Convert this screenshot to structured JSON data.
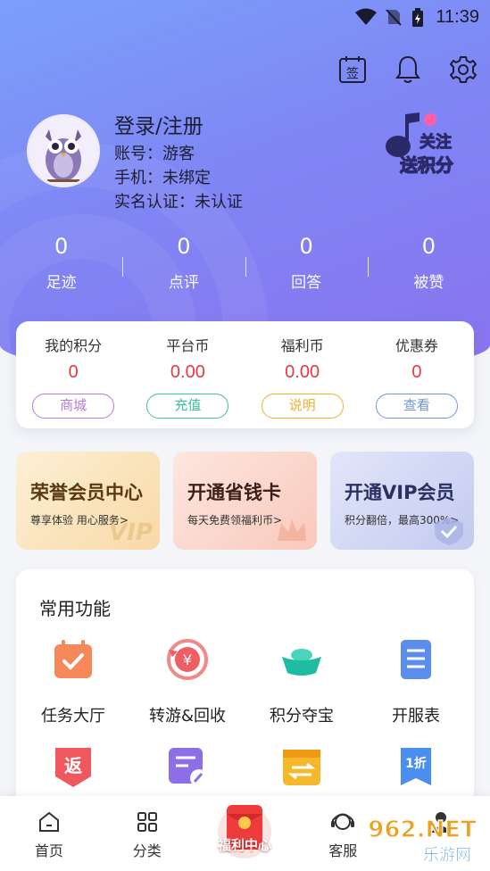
{
  "status_bar": {
    "time": "11:39"
  },
  "profile": {
    "name": "登录/注册",
    "account": "账号：游客",
    "phone": "手机：未绑定",
    "realname": "实名认证：未认证",
    "promo_line1": "关注",
    "promo_line2": "送积分"
  },
  "stats": [
    {
      "value": "0",
      "label": "足迹"
    },
    {
      "value": "0",
      "label": "点评"
    },
    {
      "value": "0",
      "label": "回答"
    },
    {
      "value": "0",
      "label": "被赞"
    }
  ],
  "wallet": [
    {
      "title": "我的积分",
      "value": "0",
      "button": "商城",
      "color": "#b67ad8"
    },
    {
      "title": "平台币",
      "value": "0.00",
      "button": "充值",
      "color": "#3dbfa3"
    },
    {
      "title": "福利币",
      "value": "0.00",
      "button": "说明",
      "color": "#f0b030"
    },
    {
      "title": "优惠券",
      "value": "0",
      "button": "查看",
      "color": "#6f95d8"
    }
  ],
  "member_cards": [
    {
      "title": "荣誉会员中心",
      "subtitle": "尊享体验 用心服务>",
      "bg": "#fbe6c4",
      "title_color": "#5a3a12",
      "deco": "VIP"
    },
    {
      "title": "开通省钱卡",
      "subtitle": "每天免费领福利币>",
      "bg": "#fbd8cf",
      "title_color": "#3a1f1a"
    },
    {
      "title": "开通VIP会员",
      "subtitle": "积分翻倍，最高300%>",
      "bg": "#d4d9f4",
      "title_color": "#2a3060"
    }
  ],
  "functions": {
    "title": "常用功能",
    "items": [
      {
        "label": "任务大厅",
        "icon": "task-icon"
      },
      {
        "label": "转游&回收",
        "icon": "recycle-icon"
      },
      {
        "label": "积分夺宝",
        "icon": "treasure-icon"
      },
      {
        "label": "开服表",
        "icon": "server-list-icon"
      },
      {
        "label": "",
        "icon": "rebate-icon",
        "glyph": "返"
      },
      {
        "label": "",
        "icon": "edit-doc-icon"
      },
      {
        "label": "",
        "icon": "transfer-icon"
      },
      {
        "label": "",
        "icon": "discount-icon",
        "glyph": "1折"
      }
    ]
  },
  "icons": {
    "sign": "签"
  },
  "tabs": [
    {
      "label": "首页",
      "icon": "home-icon"
    },
    {
      "label": "分类",
      "icon": "category-icon"
    },
    {
      "label": "福利中心",
      "icon": "gift-icon"
    },
    {
      "label": "客服",
      "icon": "support-icon"
    },
    {
      "label": "",
      "icon": "profile-icon"
    }
  ],
  "watermark": {
    "line1": "962.NET",
    "line2": "乐游网"
  }
}
